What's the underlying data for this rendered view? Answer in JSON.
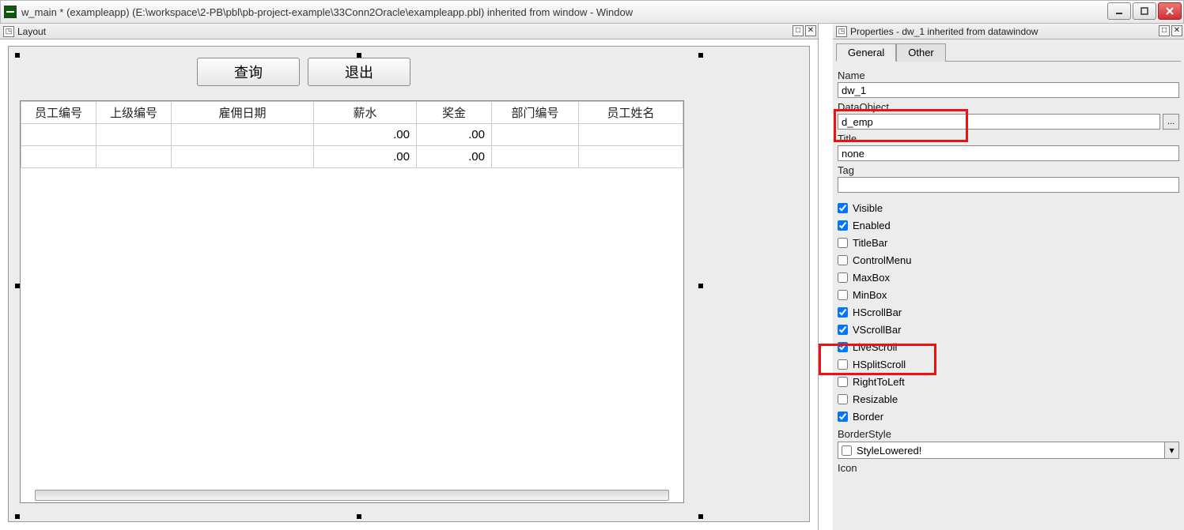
{
  "window": {
    "title": "w_main * (exampleapp) (E:\\workspace\\2-PB\\pbl\\pb-project-example\\33Conn2Oracle\\exampleapp.pbl) inherited from window - Window"
  },
  "layoutPane": {
    "title": "Layout",
    "buttons": {
      "query": "查询",
      "exit": "退出"
    },
    "columns": [
      "员工编号",
      "上级编号",
      "雇佣日期",
      "薪水",
      "奖金",
      "部门编号",
      "员工姓名"
    ],
    "rows": [
      {
        "c0": "",
        "c1": "",
        "c2": "",
        "c3": ".00",
        "c4": ".00",
        "c5": "",
        "c6": ""
      },
      {
        "c0": "",
        "c1": "",
        "c2": "",
        "c3": ".00",
        "c4": ".00",
        "c5": "",
        "c6": ""
      }
    ]
  },
  "propsPane": {
    "title": "Properties - dw_1 inherited from datawindow",
    "tabs": {
      "general": "General",
      "other": "Other"
    },
    "labels": {
      "name": "Name",
      "dataObject": "DataObject",
      "title": "Title",
      "tag": "Tag",
      "borderStyle": "BorderStyle",
      "icon": "Icon"
    },
    "values": {
      "name": "dw_1",
      "dataObject": "d_emp",
      "title": "none",
      "tag": "",
      "borderStyle": "StyleLowered!"
    },
    "checks": [
      {
        "label": "Visible",
        "checked": true
      },
      {
        "label": "Enabled",
        "checked": true
      },
      {
        "label": "TitleBar",
        "checked": false
      },
      {
        "label": "ControlMenu",
        "checked": false
      },
      {
        "label": "MaxBox",
        "checked": false
      },
      {
        "label": "MinBox",
        "checked": false
      },
      {
        "label": "HScrollBar",
        "checked": true
      },
      {
        "label": "VScrollBar",
        "checked": true
      },
      {
        "label": "LiveScroll",
        "checked": true
      },
      {
        "label": "HSplitScroll",
        "checked": false
      },
      {
        "label": "RightToLeft",
        "checked": false
      },
      {
        "label": "Resizable",
        "checked": false
      },
      {
        "label": "Border",
        "checked": true
      }
    ]
  }
}
